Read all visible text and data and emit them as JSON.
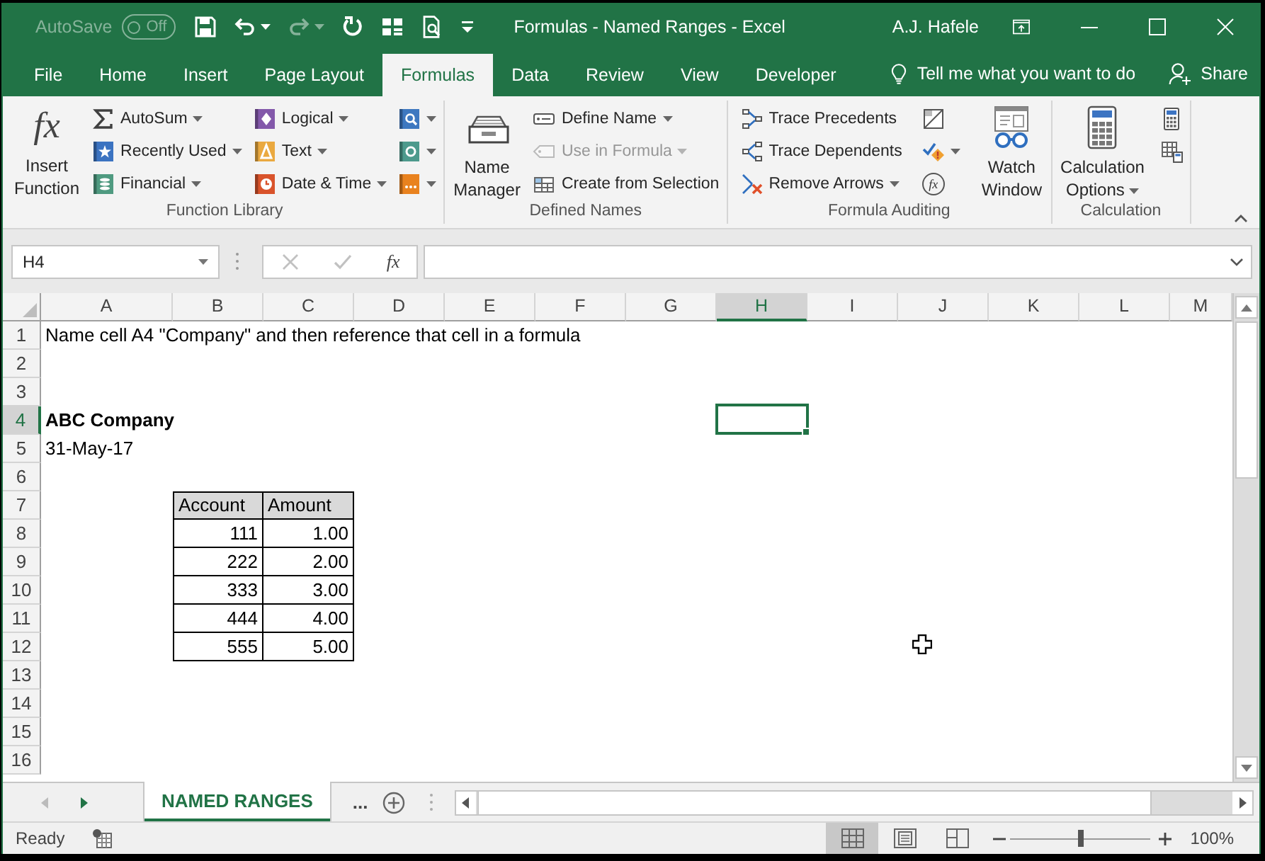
{
  "title_bar": {
    "autosave": {
      "label": "AutoSave",
      "state": "Off",
      "on": false,
      "disabled": true
    },
    "quick_access": [
      {
        "dropdown": false,
        "disabled": false
      },
      {
        "dropdown": true,
        "disabled": false
      },
      {
        "dropdown": true,
        "disabled": true
      },
      {
        "dropdown": false,
        "disabled": false
      },
      {
        "dropdown": false,
        "disabled": false
      },
      {
        "dropdown": false,
        "disabled": false
      },
      {
        "dropdown": false,
        "disabled": false
      }
    ],
    "title": "Formulas - Named Ranges - Excel",
    "user": "A.J. Hafele"
  },
  "tabs": [
    {
      "label": "File",
      "selected": false
    },
    {
      "label": "Home",
      "selected": false
    },
    {
      "label": "Insert",
      "selected": false
    },
    {
      "label": "Page Layout",
      "selected": false
    },
    {
      "label": "Formulas",
      "selected": true
    },
    {
      "label": "Data",
      "selected": false
    },
    {
      "label": "Review",
      "selected": false
    },
    {
      "label": "View",
      "selected": false
    },
    {
      "label": "Developer",
      "selected": false
    }
  ],
  "tell_me": {
    "placeholder": "Tell me what you want to do"
  },
  "share": {
    "label": "Share"
  },
  "ribbon": {
    "groups": [
      {
        "title": "Function Library",
        "items": [
          {
            "kind": "large",
            "label": "Insert Function",
            "symbol": "fx",
            "dropdown": false,
            "disabled": false
          },
          {
            "kind": "stack",
            "buttons": [
              {
                "label": "AutoSum",
                "dropdown": true,
                "disabled": false
              },
              {
                "label": "Recently Used",
                "dropdown": true,
                "disabled": false
              },
              {
                "label": "Financial",
                "dropdown": true,
                "disabled": false
              }
            ]
          },
          {
            "kind": "stack",
            "buttons": [
              {
                "label": "Logical",
                "dropdown": true,
                "disabled": false
              },
              {
                "label": "Text",
                "dropdown": true,
                "disabled": false
              },
              {
                "label": "Date & Time",
                "dropdown": true,
                "disabled": false
              }
            ]
          },
          {
            "kind": "stack",
            "buttons": [
              {
                "dropdown": true,
                "disabled": false
              },
              {
                "dropdown": true,
                "disabled": false
              },
              {
                "dropdown": true,
                "disabled": false
              }
            ]
          }
        ]
      },
      {
        "title": "Defined Names",
        "items": [
          {
            "kind": "large",
            "label": "Name Manager",
            "dropdown": false,
            "disabled": false
          },
          {
            "kind": "stack",
            "buttons": [
              {
                "label": "Define Name",
                "dropdown": true,
                "disabled": false
              },
              {
                "label": "Use in Formula",
                "dropdown": true,
                "disabled": true
              },
              {
                "label": "Create from Selection",
                "dropdown": false,
                "disabled": false
              }
            ]
          }
        ]
      },
      {
        "title": "Formula Auditing",
        "items": [
          {
            "kind": "stack",
            "buttons": [
              {
                "label": "Trace Precedents",
                "dropdown": false,
                "disabled": false
              },
              {
                "label": "Trace Dependents",
                "dropdown": false,
                "disabled": false
              },
              {
                "label": "Remove Arrows",
                "dropdown": true,
                "disabled": false
              }
            ]
          },
          {
            "kind": "stack",
            "buttons": [
              {
                "dropdown": false,
                "disabled": false
              },
              {
                "dropdown": true,
                "disabled": false
              },
              {
                "symbol": "fx",
                "dropdown": false,
                "disabled": false
              }
            ]
          },
          {
            "kind": "large",
            "label": "Watch Window",
            "dropdown": false,
            "disabled": false
          }
        ]
      },
      {
        "title": "Calculation",
        "items": [
          {
            "kind": "large",
            "label": "Calculation Options",
            "dropdown": true,
            "disabled": false
          },
          {
            "kind": "stack",
            "buttons": [
              {
                "dropdown": false,
                "disabled": false
              },
              {
                "dropdown": false,
                "disabled": false
              }
            ]
          }
        ]
      }
    ]
  },
  "formula_bar": {
    "name_box": "H4",
    "buttons": [
      {
        "disabled": true
      },
      {
        "disabled": true
      },
      {
        "symbol": "fx",
        "disabled": false
      }
    ]
  },
  "sheet": {
    "columns": [
      {
        "label": "A",
        "selected": false
      },
      {
        "label": "B",
        "selected": false
      },
      {
        "label": "C",
        "selected": false
      },
      {
        "label": "D",
        "selected": false
      },
      {
        "label": "E",
        "selected": false
      },
      {
        "label": "F",
        "selected": false
      },
      {
        "label": "G",
        "selected": false
      },
      {
        "label": "H",
        "selected": true
      },
      {
        "label": "I",
        "selected": false
      },
      {
        "label": "J",
        "selected": false
      },
      {
        "label": "K",
        "selected": false
      },
      {
        "label": "L",
        "selected": false
      },
      {
        "label": "M",
        "selected": false
      }
    ],
    "rows": [
      {
        "label": "1",
        "selected": false
      },
      {
        "label": "2",
        "selected": false
      },
      {
        "label": "3",
        "selected": false
      },
      {
        "label": "4",
        "selected": true
      },
      {
        "label": "5",
        "selected": false
      },
      {
        "label": "6",
        "selected": false
      },
      {
        "label": "7",
        "selected": false
      },
      {
        "label": "8",
        "selected": false
      },
      {
        "label": "9",
        "selected": false
      },
      {
        "label": "10",
        "selected": false
      },
      {
        "label": "11",
        "selected": false
      },
      {
        "label": "12",
        "selected": false
      },
      {
        "label": "13",
        "selected": false
      },
      {
        "label": "14",
        "selected": false
      },
      {
        "label": "15",
        "selected": false
      },
      {
        "label": "16",
        "selected": false
      }
    ],
    "note": "Name cell A4 \"Company\" and then reference that cell in a formula",
    "company": "ABC Company",
    "date": "31-May-17",
    "table": {
      "header": [
        "Account",
        "Amount"
      ],
      "rows": [
        [
          "111",
          "1.00"
        ],
        [
          "222",
          "2.00"
        ],
        [
          "333",
          "3.00"
        ],
        [
          "444",
          "4.00"
        ],
        [
          "555",
          "5.00"
        ]
      ]
    }
  },
  "sheet_tabs": {
    "previous_disabled": true,
    "next_disabled": false,
    "tabs": [
      {
        "label": "NAMED RANGES",
        "selected": true
      }
    ],
    "more": "..."
  },
  "status_bar": {
    "status": "Ready",
    "views": [
      {
        "selected": true
      },
      {
        "selected": false
      },
      {
        "selected": false
      }
    ],
    "zoom": {
      "level": 0.5,
      "label": "100%"
    }
  }
}
